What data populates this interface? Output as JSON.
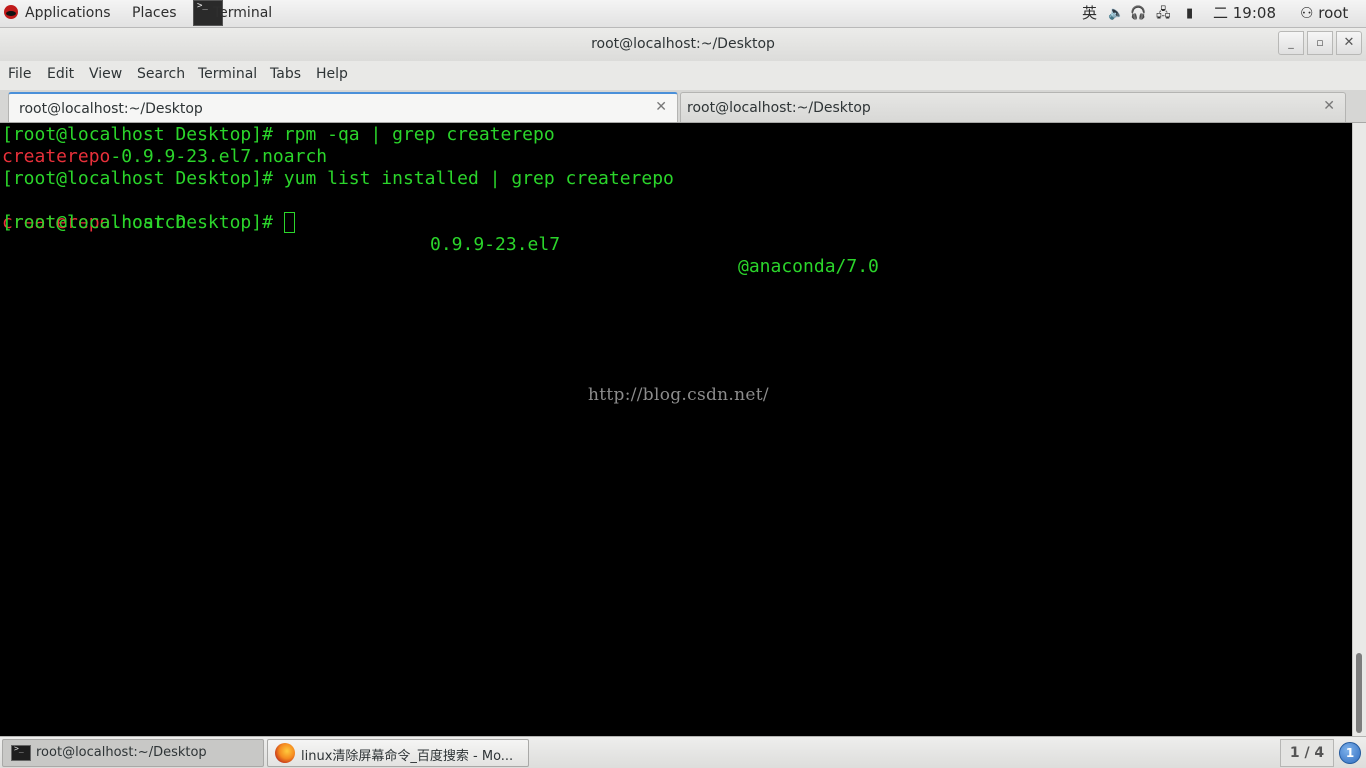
{
  "top_panel": {
    "applications": "Applications",
    "places": "Places",
    "terminal_launcher": "Terminal",
    "ime": "英",
    "clock": "二 19:08",
    "user": "root"
  },
  "window": {
    "title": "root@localhost:~/Desktop",
    "min": "_",
    "max": "▫",
    "close": "✕"
  },
  "menubar": [
    "File",
    "Edit",
    "View",
    "Search",
    "Terminal",
    "Tabs",
    "Help"
  ],
  "tabs": [
    {
      "label": "root@localhost:~/Desktop",
      "active": true
    },
    {
      "label": "root@localhost:~/Desktop",
      "active": false
    }
  ],
  "terminal": {
    "prompt": "[root@localhost Desktop]# ",
    "cmd1": "rpm -qa | grep createrepo",
    "out1_match": "createrepo",
    "out1_rest": "-0.9.9-23.el7.noarch",
    "cmd2": "yum list installed | grep createrepo",
    "out2_match": "createrepo",
    "out2_arch": ".noarch",
    "out2_version": "0.9.9-23.el7",
    "out2_repo": "@anaconda/7.0",
    "watermark": "http://blog.csdn.net/",
    "colors": {
      "green": "#2bd52b",
      "red": "#e8303a",
      "background": "#000000"
    }
  },
  "taskbar": {
    "tasks": [
      {
        "label": "root@localhost:~/Desktop",
        "icon": "terminal-icon"
      },
      {
        "label": "linux清除屏幕命令_百度搜索 - Mo...",
        "icon": "firefox-icon"
      }
    ],
    "workspace": "1 / 4",
    "notifications": "1"
  }
}
